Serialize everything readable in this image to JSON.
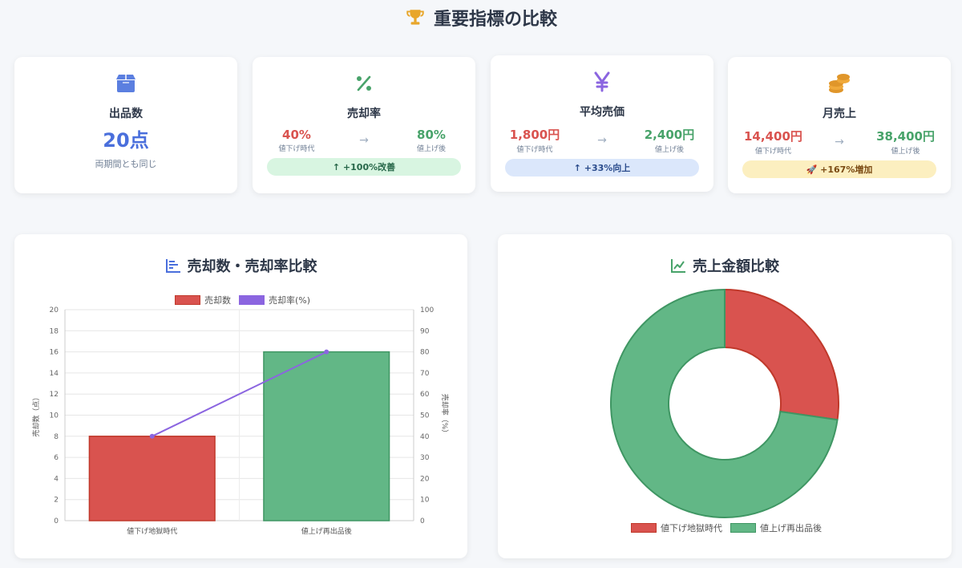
{
  "page": {
    "title": "重要指標の比較",
    "title_icon": "trophy-icon"
  },
  "kpis": {
    "listings": {
      "icon": "box-icon",
      "label": "出品数",
      "value": "20点",
      "note": "両期間とも同じ"
    },
    "sell_rate": {
      "icon": "percent-icon",
      "label": "売却率",
      "before": "40%",
      "before_label": "値下げ時代",
      "after": "80%",
      "after_label": "値上げ後",
      "change": "↑ +100%改善"
    },
    "avg_price": {
      "icon": "yen-icon",
      "label": "平均売価",
      "before": "1,800円",
      "before_label": "値下げ時代",
      "after": "2,400円",
      "after_label": "値上げ後",
      "change": "↑ +33%向上"
    },
    "monthly_sales": {
      "icon": "coins-icon",
      "label": "月売上",
      "before": "14,400円",
      "before_label": "値下げ時代",
      "after": "38,400円",
      "after_label": "値上げ後",
      "change": "🚀 +167%増加"
    }
  },
  "colors": {
    "red": "#d9534f",
    "green": "#62b786",
    "purple": "#8b65e0",
    "blue": "#4a6fdc"
  },
  "chart_data": [
    {
      "type": "bar",
      "title": "売却数・売却率比較",
      "categories": [
        "値下げ地獄時代",
        "値上げ再出品後"
      ],
      "series": [
        {
          "name": "売却数",
          "type": "bar",
          "axis": "left",
          "values": [
            8,
            16
          ]
        },
        {
          "name": "売却率(%)",
          "type": "line",
          "axis": "right",
          "values": [
            40,
            80
          ]
        }
      ],
      "ylabel": "売却数（点）",
      "y2label": "売却率（%）",
      "ylim": [
        0,
        20
      ],
      "y2lim": [
        0,
        100
      ],
      "yticks": [
        "0",
        "2",
        "4",
        "6",
        "8",
        "10",
        "12",
        "14",
        "16",
        "18",
        "20"
      ],
      "y2ticks": [
        "0",
        "10",
        "20",
        "30",
        "40",
        "50",
        "60",
        "70",
        "80",
        "90",
        "100"
      ],
      "grid": true,
      "legend": "top"
    },
    {
      "type": "pie",
      "title": "売上金額比較",
      "labels": [
        "値下げ地獄時代",
        "値上げ再出品後"
      ],
      "values": [
        14400,
        38400
      ],
      "donut": true,
      "legend": "bottom"
    }
  ]
}
